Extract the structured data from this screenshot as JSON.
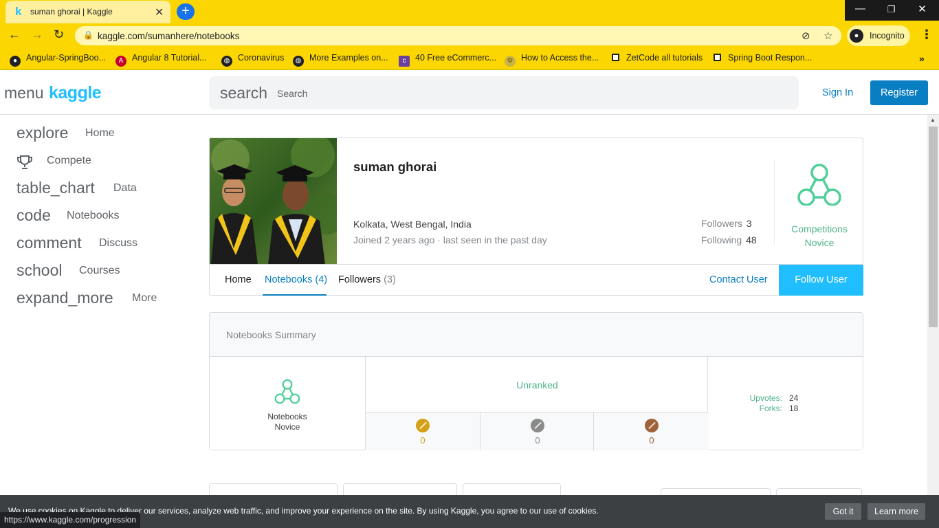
{
  "browser": {
    "tab_title": "suman ghorai | Kaggle",
    "tab_favicon": "k",
    "url": "kaggle.com/sumanhere/notebooks",
    "incognito_label": "Incognito",
    "bookmarks": [
      {
        "label": "Angular-SpringBoo...",
        "icon": "github-icon"
      },
      {
        "label": "Angular 8 Tutorial...",
        "icon": "angular-icon"
      },
      {
        "label": "Coronavirus",
        "icon": "globe-icon"
      },
      {
        "label": "More Examples on...",
        "icon": "globe-icon"
      },
      {
        "label": "40 Free eCommerc...",
        "icon": "colorlib-icon"
      },
      {
        "label": "How to Access the...",
        "icon": "gear-icon"
      },
      {
        "label": "ZetCode all tutorials",
        "icon": "page-icon"
      },
      {
        "label": "Spring Boot Respon...",
        "icon": "page-icon"
      }
    ],
    "status_url": "https://www.kaggle.com/progression"
  },
  "header": {
    "menu_icon": "menu",
    "logo": "kaggle",
    "search_icon": "search",
    "search_placeholder": "Search",
    "sign_in": "Sign In",
    "register": "Register"
  },
  "sidebar": {
    "items": [
      {
        "icon": "explore",
        "label": "Home"
      },
      {
        "icon": "trophy-icon",
        "label": "Compete"
      },
      {
        "icon": "table_chart",
        "label": "Data"
      },
      {
        "icon": "code",
        "label": "Notebooks"
      },
      {
        "icon": "comment",
        "label": "Discuss"
      },
      {
        "icon": "school",
        "label": "Courses"
      },
      {
        "icon": "expand_more",
        "label": "More"
      }
    ]
  },
  "profile": {
    "name": "suman ghorai",
    "location": "Kolkata, West Bengal, India",
    "joined": "Joined 2 years ago · last seen in the past day",
    "followers_label": "Followers",
    "followers": "3",
    "following_label": "Following",
    "following": "48",
    "tier_line1": "Competitions",
    "tier_line2": "Novice",
    "tabs": {
      "home": "Home",
      "notebooks": "Notebooks",
      "notebooks_count": "(4)",
      "followers": "Followers",
      "followers_count": "(3)"
    },
    "contact": "Contact User",
    "follow": "Follow User"
  },
  "summary": {
    "title": "Notebooks Summary",
    "tier_line1": "Notebooks",
    "tier_line2": "Novice",
    "rank": "Unranked",
    "medals": [
      {
        "type": "gold",
        "count": "0",
        "color": "#d4a017"
      },
      {
        "type": "silver",
        "count": "0",
        "color": "#8a8a8a"
      },
      {
        "type": "bronze",
        "count": "0",
        "color": "#a0623a"
      }
    ],
    "upvotes_label": "Upvotes:",
    "upvotes": "24",
    "forks_label": "Forks:",
    "forks": "18"
  },
  "cookie": {
    "text": "We use cookies on Kaggle to deliver our services, analyze web traffic, and improve your experience on the site. By using Kaggle, you agree to our use of cookies.",
    "got_it": "Got it",
    "learn_more": "Learn more"
  },
  "colors": {
    "chrome_yellow": "#fbd600",
    "kaggle_blue": "#20beff",
    "link_blue": "#0a7ec2",
    "tier_green": "#4fb38a"
  }
}
